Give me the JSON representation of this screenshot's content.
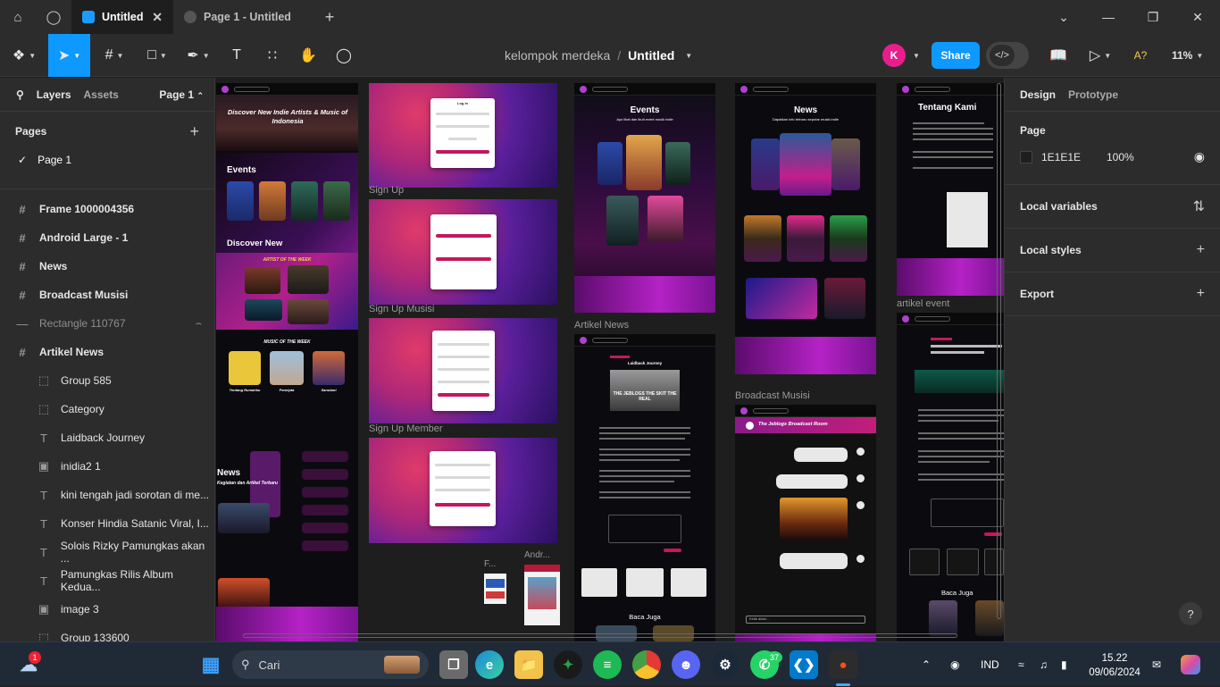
{
  "window": {
    "tabs": [
      {
        "label": "Untitled",
        "active": true
      },
      {
        "label": "Page 1 - Untitled",
        "active": false
      }
    ]
  },
  "toolbar": {
    "project": "kelompok merdeka",
    "separator": "/",
    "file_name": "Untitled",
    "avatar_initial": "K",
    "share_label": "Share",
    "zoom": "11%",
    "accent": "#0d99ff"
  },
  "left_panel": {
    "tab_layers": "Layers",
    "tab_assets": "Assets",
    "page_selector": "Page 1",
    "pages_title": "Pages",
    "pages": [
      "Page 1"
    ],
    "layers": [
      {
        "label": "Frame 1000004356",
        "icon": "frame-icon",
        "level": 0
      },
      {
        "label": "Android Large - 1",
        "icon": "frame-icon",
        "level": 0
      },
      {
        "label": "News",
        "icon": "frame-icon",
        "level": 0
      },
      {
        "label": "Broadcast Musisi",
        "icon": "frame-icon",
        "level": 0
      },
      {
        "label": "Rectangle 110767",
        "icon": "rectangle-icon",
        "level": 0,
        "hidden": true
      },
      {
        "label": "Artikel News",
        "icon": "frame-icon",
        "level": 0
      },
      {
        "label": "Group 585",
        "icon": "group-icon",
        "level": 1
      },
      {
        "label": "Category",
        "icon": "group-icon",
        "level": 1
      },
      {
        "label": "Laidback Journey",
        "icon": "text-icon",
        "level": 1
      },
      {
        "label": "inidia2 1",
        "icon": "image-icon",
        "level": 1
      },
      {
        "label": "kini tengah jadi sorotan di me...",
        "icon": "text-icon",
        "level": 1
      },
      {
        "label": "Konser Hindia Satanic Viral, I...",
        "icon": "text-icon",
        "level": 1
      },
      {
        "label": "Solois Rizky Pamungkas akan ...",
        "icon": "text-icon",
        "level": 1
      },
      {
        "label": "Pamungkas Rilis Album Kedua...",
        "icon": "text-icon",
        "level": 1
      },
      {
        "label": "image 3",
        "icon": "image-icon",
        "level": 1
      },
      {
        "label": "Group 133600",
        "icon": "group-icon",
        "level": 1
      }
    ]
  },
  "canvas": {
    "frame_labels": {
      "signup": "Sign Up",
      "signup_musisi": "Sign Up Musisi",
      "signup_member": "Sign Up Member",
      "artikel_news": "Artikel News",
      "broadcast": "Broadcast Musisi",
      "artikel_event": "artikel event",
      "f_small": "F...",
      "andr_small": "Andr..."
    },
    "home": {
      "hero": "Discover New Indie Artists & Music of Indonesia",
      "events": "Events",
      "discover": "Discover New",
      "artist_week": "ARTIST OF THE WEEK",
      "music_week": "MUSIC OF THE WEEK",
      "song1": "Tentang Rumahku",
      "song2": "Pencipta",
      "song3": "Sanubari",
      "news": "News",
      "news_sub": "Kegiatan dan Artikel Terbaru"
    },
    "login": {
      "title": "Log in"
    },
    "events_frame": {
      "title": "Events",
      "subtitle": "Ayo lihat dan ikuti event musik indie"
    },
    "news_frame": {
      "title": "News",
      "subtitle": "Dapatkan info terbaru seputar musik indie"
    },
    "laidback": {
      "title": "Laidback Journey",
      "banner": "THE JEBLOGS THE SKIT THE REAL",
      "related": "Baca Juga"
    },
    "broadcast": {
      "room": "The Jeblogs Broadcast Room",
      "input": "Ketik disini..."
    },
    "tentang": {
      "title": "Tentang Kami"
    },
    "event_article": {
      "related": "Baca Juga"
    }
  },
  "right_panel": {
    "tab_design": "Design",
    "tab_prototype": "Prototype",
    "page_title": "Page",
    "page_color": "1E1E1E",
    "page_opacity": "100%",
    "local_variables": "Local variables",
    "local_styles": "Local styles",
    "export": "Export",
    "help": "?"
  },
  "taskbar": {
    "search": "Cari",
    "language": "IND",
    "time": "15.22",
    "date": "09/06/2024",
    "weather_badge": "1",
    "whatsapp_badge": "37"
  }
}
